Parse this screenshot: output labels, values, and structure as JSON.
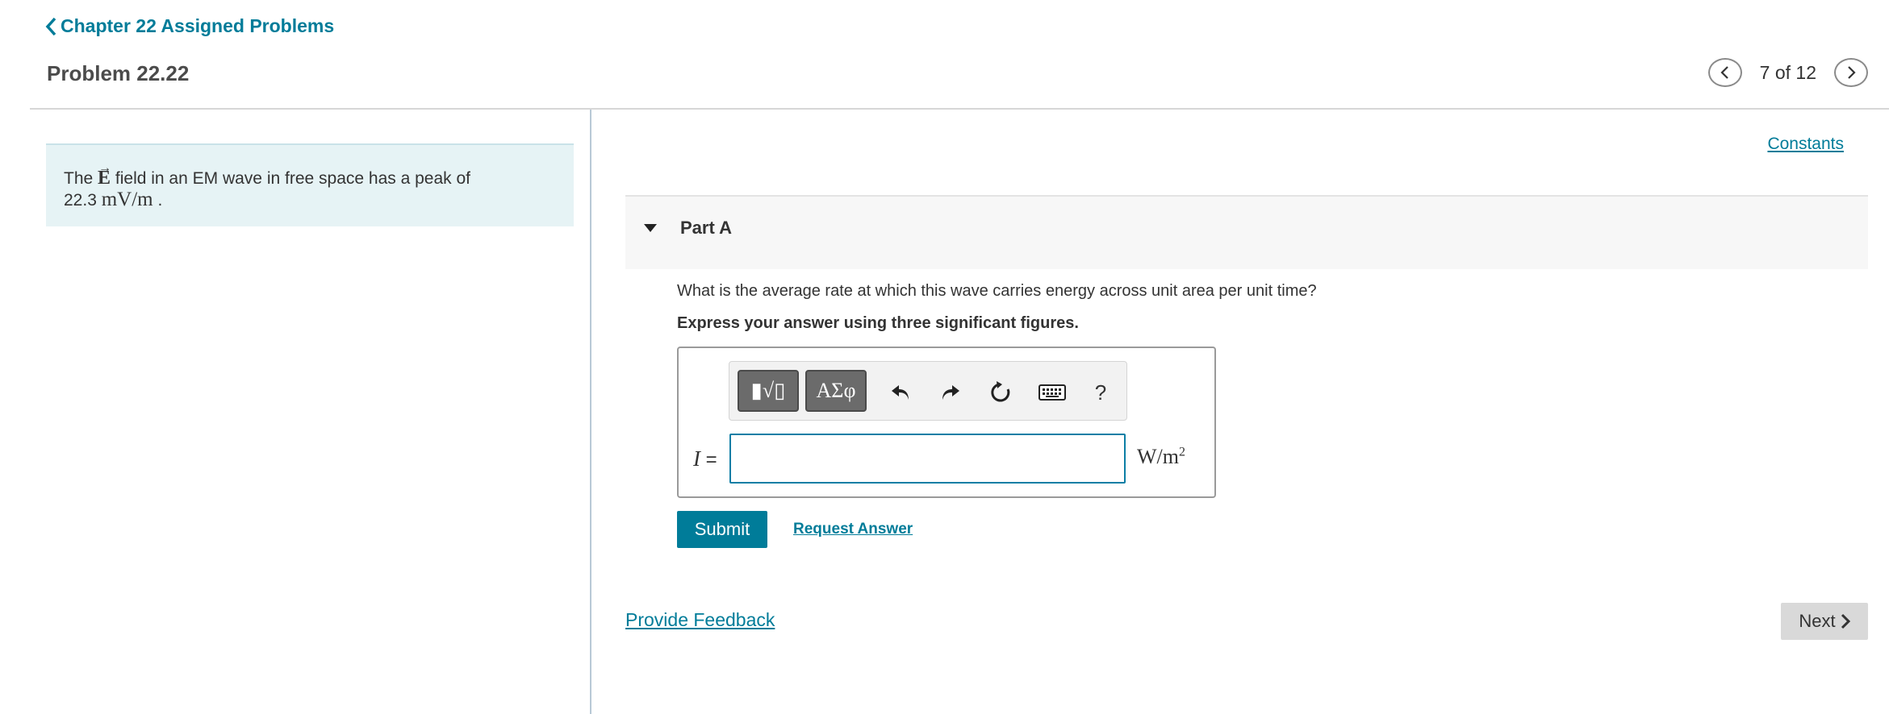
{
  "nav": {
    "back_label": "Chapter 22 Assigned Problems"
  },
  "problem": {
    "title": "Problem 22.22"
  },
  "pager": {
    "count_text": "7 of 12"
  },
  "intro": {
    "text_before": "The",
    "vector_symbol": "E",
    "text_after": "field in an EM wave in free space has a peak of",
    "value": "22.3",
    "unit": "mV/m",
    "end": "."
  },
  "constants_link": "Constants",
  "part": {
    "label": "Part A",
    "question": "What is the average rate at which this wave carries energy across unit area per unit time?",
    "instruction": "Express your answer using three significant figures."
  },
  "toolbar": {
    "template_button": "▮√▯",
    "greek_button": "ΑΣφ",
    "help_label": "?"
  },
  "answer": {
    "variable": "I",
    "equals": "=",
    "value": "",
    "unit_base": "W/m",
    "unit_exp": "2"
  },
  "actions": {
    "submit_label": "Submit",
    "request_answer_label": "Request Answer",
    "feedback_label": "Provide Feedback",
    "next_label": "Next"
  },
  "colors": {
    "accent": "#007c99",
    "intro_bg": "#e6f3f5",
    "next_bg": "#d9d9d9"
  }
}
